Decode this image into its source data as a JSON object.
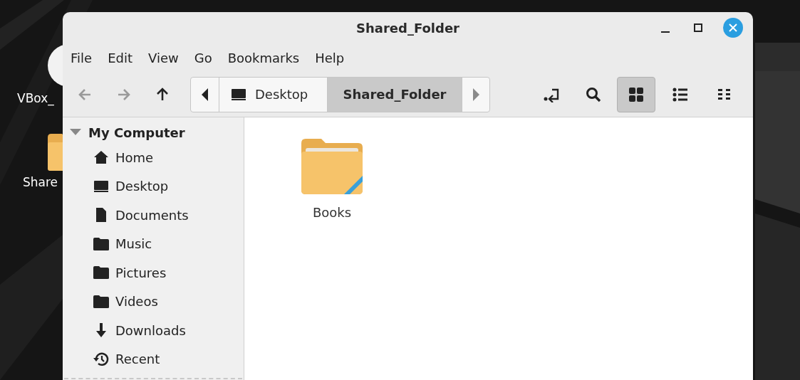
{
  "desktop_icons": [
    {
      "label": "VBox_",
      "kind": "disc"
    },
    {
      "label": "Share",
      "kind": "folder"
    }
  ],
  "window": {
    "title": "Shared_Folder"
  },
  "menu": [
    "File",
    "Edit",
    "View",
    "Go",
    "Bookmarks",
    "Help"
  ],
  "nav_buttons": [
    {
      "kind": "back",
      "disabled": true
    },
    {
      "kind": "forward",
      "disabled": true
    },
    {
      "kind": "up",
      "disabled": false
    }
  ],
  "path_bar": [
    {
      "label": "Desktop",
      "selected": false
    },
    {
      "label": "Shared_Folder",
      "selected": true
    }
  ],
  "view_modes": [
    {
      "kind": "icons",
      "selected": true
    },
    {
      "kind": "list",
      "selected": false
    },
    {
      "kind": "compact",
      "selected": false
    }
  ],
  "sidebar": {
    "section": "My Computer",
    "expanded": true,
    "items": [
      {
        "label": "Home",
        "kind": "home"
      },
      {
        "label": "Desktop",
        "kind": "desktop"
      },
      {
        "label": "Documents",
        "kind": "document"
      },
      {
        "label": "Music",
        "kind": "folder"
      },
      {
        "label": "Pictures",
        "kind": "folder"
      },
      {
        "label": "Videos",
        "kind": "folder"
      },
      {
        "label": "Downloads",
        "kind": "download"
      },
      {
        "label": "Recent",
        "kind": "recent"
      }
    ]
  },
  "files": [
    {
      "name": "Books"
    }
  ]
}
